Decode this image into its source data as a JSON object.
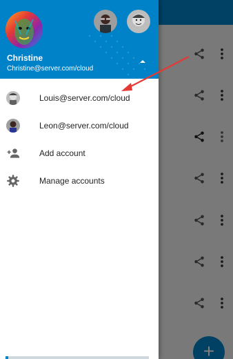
{
  "colors": {
    "brand": "#0082c9",
    "arrow": "#e53935",
    "text": "#222222"
  },
  "account": {
    "name": "Christine",
    "email": "Christine@server.com/cloud"
  },
  "menu": {
    "items": [
      {
        "label": "Louis@server.com/cloud",
        "icon": "avatar-louis"
      },
      {
        "label": "Leon@server.com/cloud",
        "icon": "avatar-leon"
      },
      {
        "label": "Add account",
        "icon": "add-person-icon"
      },
      {
        "label": "Manage accounts",
        "icon": "gear-icon"
      }
    ]
  },
  "fab": {
    "label": "+"
  }
}
